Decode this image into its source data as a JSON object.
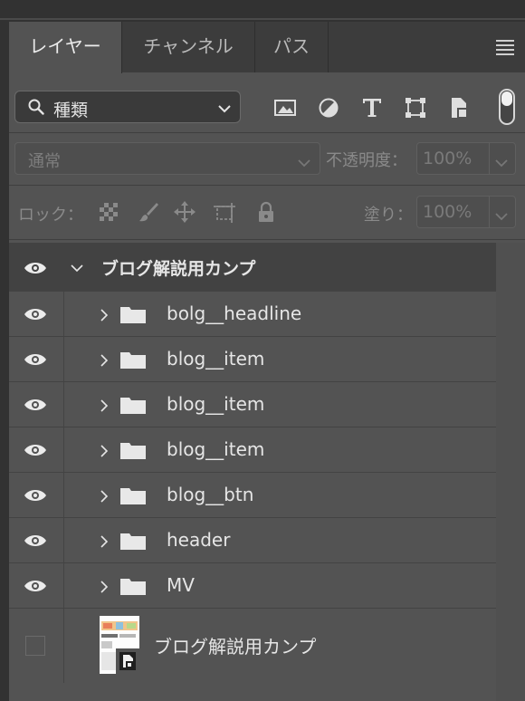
{
  "tabs": [
    {
      "label": "レイヤー",
      "active": true
    },
    {
      "label": "チャンネル",
      "active": false
    },
    {
      "label": "パス",
      "active": false
    }
  ],
  "filter": {
    "kind_label": "種類",
    "filter_icons": [
      "image-filter-icon",
      "adjustment-filter-icon",
      "type-filter-icon",
      "shape-filter-icon",
      "smart-object-filter-icon"
    ]
  },
  "blend": {
    "mode": "通常",
    "opacity_label": "不透明度：",
    "opacity_value": "100%"
  },
  "lock": {
    "label": "ロック：",
    "fill_label": "塗り：",
    "fill_value": "100%"
  },
  "layers": {
    "group": {
      "name": "ブログ解説用カンプ",
      "expanded": true
    },
    "children": [
      {
        "name": "bolg__headline"
      },
      {
        "name": "blog__item"
      },
      {
        "name": "blog__item"
      },
      {
        "name": "blog__item"
      },
      {
        "name": "blog__btn"
      },
      {
        "name": "header"
      },
      {
        "name": "MV"
      }
    ],
    "bottom": {
      "name": "ブログ解説用カンプ"
    }
  },
  "colors": {
    "panel": "#535353",
    "tabbar": "#3c3c3c",
    "text": "#e6e6e6"
  }
}
